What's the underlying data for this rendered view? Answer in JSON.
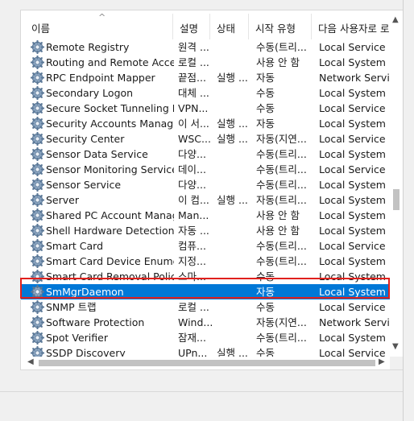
{
  "columns": {
    "name": "이름",
    "desc": "설명",
    "state": "상태",
    "start": "시작 유형",
    "logon": "다음 사용자로 로"
  },
  "icons": {
    "service": "gear-icon",
    "sort": "chevron-up-icon"
  },
  "selected_color": "#0078d7",
  "highlight_color": "#e0201c",
  "services": [
    {
      "name": "Remote Registry",
      "desc": "원격 ...",
      "state": "",
      "start": "수동(트리...",
      "logon": "Local Service"
    },
    {
      "name": "Routing and Remote Access",
      "desc": "로컬 ...",
      "state": "",
      "start": "사용 안 함",
      "logon": "Local System"
    },
    {
      "name": "RPC Endpoint Mapper",
      "desc": "끝점...",
      "state": "실행 ...",
      "start": "자동",
      "logon": "Network Service"
    },
    {
      "name": "Secondary Logon",
      "desc": "대체 ...",
      "state": "",
      "start": "수동",
      "logon": "Local System"
    },
    {
      "name": "Secure Socket Tunneling P...",
      "desc": "VPN...",
      "state": "",
      "start": "수동",
      "logon": "Local Service"
    },
    {
      "name": "Security Accounts Manager",
      "desc": "이 서...",
      "state": "실행 ...",
      "start": "자동",
      "logon": "Local System"
    },
    {
      "name": "Security Center",
      "desc": "WSC...",
      "state": "실행 ...",
      "start": "자동(지연...",
      "logon": "Local Service"
    },
    {
      "name": "Sensor Data Service",
      "desc": "다양...",
      "state": "",
      "start": "수동(트리...",
      "logon": "Local System"
    },
    {
      "name": "Sensor Monitoring Service",
      "desc": "데이...",
      "state": "",
      "start": "수동(트리...",
      "logon": "Local Service"
    },
    {
      "name": "Sensor Service",
      "desc": "다양...",
      "state": "",
      "start": "수동(트리...",
      "logon": "Local System"
    },
    {
      "name": "Server",
      "desc": "이 컴...",
      "state": "실행 ...",
      "start": "자동(트리...",
      "logon": "Local System"
    },
    {
      "name": "Shared PC Account Manager",
      "desc": "Man...",
      "state": "",
      "start": "사용 안 함",
      "logon": "Local System"
    },
    {
      "name": "Shell Hardware Detection",
      "desc": "자동 ...",
      "state": "",
      "start": "사용 안 함",
      "logon": "Local System"
    },
    {
      "name": "Smart Card",
      "desc": "컴퓨...",
      "state": "",
      "start": "수동(트리...",
      "logon": "Local Service"
    },
    {
      "name": "Smart Card Device Enumer...",
      "desc": "지정...",
      "state": "",
      "start": "수동(트리...",
      "logon": "Local System"
    },
    {
      "name": "Smart Card Removal Policy",
      "desc": "스마...",
      "state": "",
      "start": "수동",
      "logon": "Local System"
    },
    {
      "name": "SmMgrDaemon",
      "desc": "",
      "state": "",
      "start": "자동",
      "logon": "Local System",
      "selected": true
    },
    {
      "name": "SNMP 트랩",
      "desc": "로컬 ...",
      "state": "",
      "start": "수동",
      "logon": "Local Service"
    },
    {
      "name": "Software Protection",
      "desc": "Wind...",
      "state": "",
      "start": "자동(지연...",
      "logon": "Network Service"
    },
    {
      "name": "Spot Verifier",
      "desc": "잠재...",
      "state": "",
      "start": "수동(트리...",
      "logon": "Local System"
    },
    {
      "name": "SSDP Discovery",
      "desc": "UPn...",
      "state": "실행 ...",
      "start": "수동",
      "logon": "Local Service"
    }
  ]
}
